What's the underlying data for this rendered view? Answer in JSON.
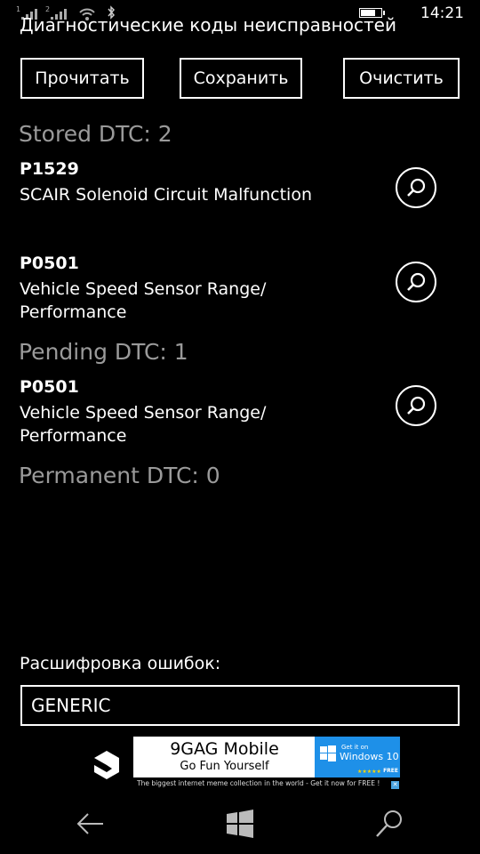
{
  "status_bar": {
    "sim1": "1",
    "sim2": "2",
    "battery_level": 0.8,
    "time": "14:21"
  },
  "page": {
    "title": "Диагностические коды неисправностей"
  },
  "toolbar": {
    "read_label": "Прочитать",
    "save_label": "Сохранить",
    "clear_label": "Очистить"
  },
  "stored": {
    "header": "Stored DTC: 2",
    "items": [
      {
        "code": "P1529",
        "description": "SCAIR Solenoid Circuit Malfunction"
      },
      {
        "code": "P0501",
        "description": "Vehicle Speed Sensor Range/ Performance"
      }
    ]
  },
  "pending": {
    "header": "Pending DTC: 1",
    "items": [
      {
        "code": "P0501",
        "description": "Vehicle Speed Sensor Range/ Performance"
      }
    ]
  },
  "permanent": {
    "header": "Permanent DTC: 0"
  },
  "decoding": {
    "label": "Расшифровка ошибок:",
    "value": "GENERIC"
  },
  "ad": {
    "title": "9GAG Mobile",
    "subtitle": "Go Fun Yourself",
    "store_line1": "Get it on",
    "store_line2": "Windows 10",
    "free": "FREE",
    "tagline": "The biggest internet meme collection in the world - Get it now for FREE !"
  },
  "nav": {
    "icons": [
      "back-icon",
      "windows-start-icon",
      "search-icon"
    ]
  },
  "colors": {
    "background": "#000000",
    "text": "#ffffff",
    "section_header": "#9a9a9a",
    "ad_store": "#1e90e8"
  }
}
